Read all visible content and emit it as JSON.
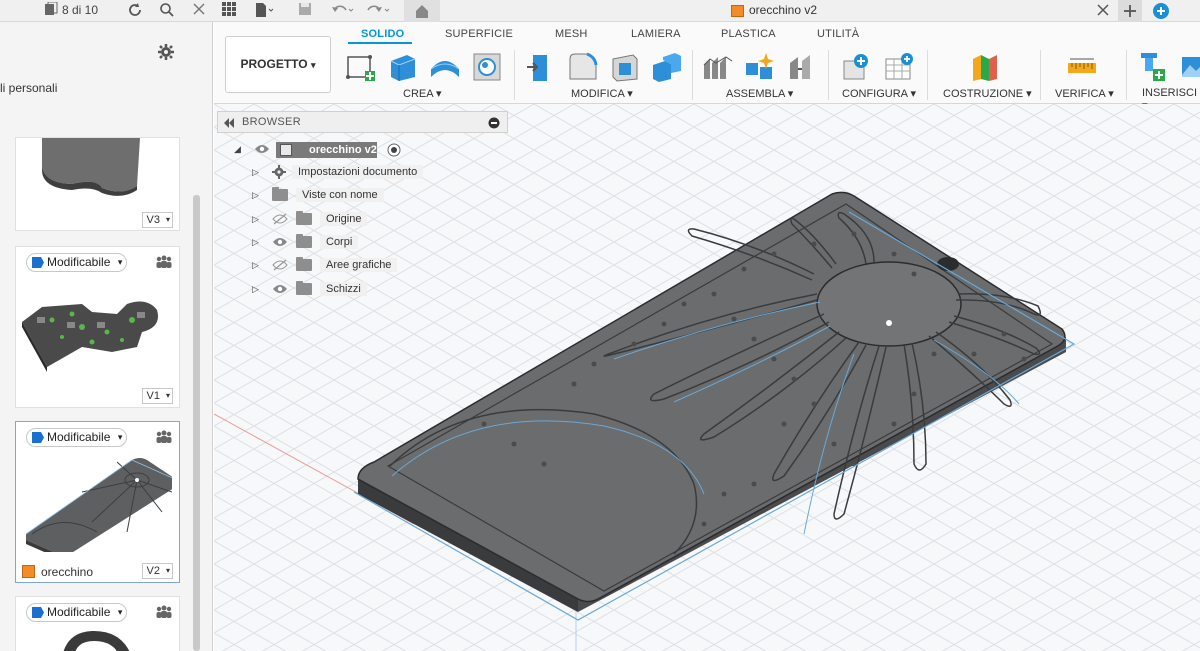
{
  "topbar": {
    "page_counter": "8 di 10",
    "doc_tab_title": "orecchino v2",
    "icons": [
      "grid-icon",
      "refresh-icon",
      "search-icon",
      "close-icon",
      "apps-icon",
      "file-icon",
      "save-icon",
      "undo-icon",
      "redo-icon",
      "home-icon",
      "new-tab-icon",
      "online-status-icon"
    ]
  },
  "left_panel": {
    "title_partial": "li personali",
    "cards": [
      {
        "version": "V3"
      },
      {
        "badge": "Modificabile",
        "version": "V1"
      },
      {
        "badge": "Modificabile",
        "version": "V2",
        "name": "orecchino"
      },
      {
        "badge": "Modificabile"
      }
    ]
  },
  "toolbar": {
    "project_button": "PROGETTO",
    "tabs": [
      "SOLIDO",
      "SUPERFICIE",
      "MESH",
      "LAMIERA",
      "PLASTICA",
      "UTILITÀ"
    ],
    "active_tab": "SOLIDO",
    "groups": {
      "crea": "CREA",
      "modifica": "MODIFICA",
      "assembla": "ASSEMBLA",
      "configura": "CONFIGURA",
      "costruzione": "COSTRUZIONE",
      "verifica": "VERIFICA",
      "inserisci": "INSERISCI"
    },
    "dropdown_glyph": "▾"
  },
  "browser": {
    "title": "BROWSER",
    "root": "orecchino v2",
    "items": [
      {
        "label": "Impostazioni documento",
        "icon": "gear-icon"
      },
      {
        "label": "Viste con nome",
        "icon": "folder-icon"
      },
      {
        "label": "Origine",
        "icon": "folder-icon",
        "visibility": "hidden"
      },
      {
        "label": "Corpi",
        "icon": "folder-icon",
        "visibility": "visible"
      },
      {
        "label": "Aree grafiche",
        "icon": "folder-icon",
        "visibility": "hidden"
      },
      {
        "label": "Schizzi",
        "icon": "folder-icon",
        "visibility": "visible"
      }
    ]
  },
  "colors": {
    "accent": "#0696d7",
    "model_gray": "#6b6c6e",
    "sketch_blue": "#6aa8d8",
    "file_orange": "#f28c28"
  }
}
